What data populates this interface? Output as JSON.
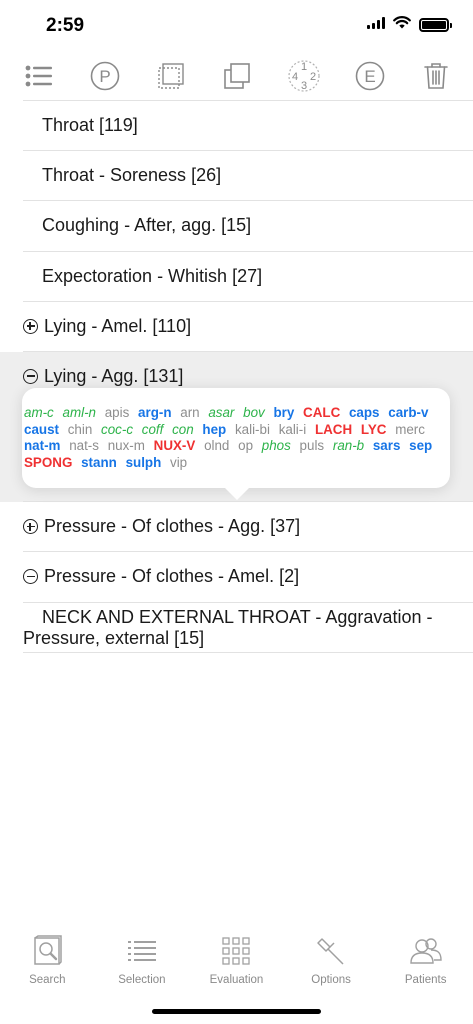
{
  "status": {
    "time": "2:59"
  },
  "toolbar": {
    "buttons": [
      {
        "icon": "list-icon"
      },
      {
        "icon": "p-circle-icon",
        "glyph": "P"
      },
      {
        "icon": "dotted-square-icon"
      },
      {
        "icon": "overlap-squares-icon"
      },
      {
        "icon": "grade-numbers-icon",
        "glyphs": [
          "1",
          "4",
          "2",
          "3"
        ]
      },
      {
        "icon": "e-circle-icon",
        "glyph": "E"
      },
      {
        "icon": "trash-icon"
      }
    ]
  },
  "rubrics": [
    {
      "label": "Throat [119]",
      "toggle": "none"
    },
    {
      "label": "Throat - Soreness [26]",
      "toggle": "none"
    },
    {
      "label": "Coughing - After, agg. [15]",
      "toggle": "none"
    },
    {
      "label": "Expectoration - Whitish [27]",
      "toggle": "none"
    },
    {
      "label": "Lying - Amel. [110]",
      "toggle": "plus"
    },
    {
      "label": "Lying - Agg. [131]",
      "toggle": "minus"
    },
    {
      "label": "Pressure - Of clothes - Agg. [37]",
      "toggle": "plus"
    },
    {
      "label": "Pressure - Of clothes - Amel. [2]",
      "toggle": "minus"
    },
    {
      "label_line1": "NECK AND EXTERNAL THROAT - Aggravation -",
      "label_line2": "Pressure, external [15]",
      "toggle": "none"
    }
  ],
  "popover": {
    "remedies": [
      {
        "name": "am-c",
        "grade": 2
      },
      {
        "name": "aml-n",
        "grade": 2
      },
      {
        "name": "apis",
        "grade": 1
      },
      {
        "name": "arg-n",
        "grade": 3
      },
      {
        "name": "arn",
        "grade": 1
      },
      {
        "name": "asar",
        "grade": 2
      },
      {
        "name": "bov",
        "grade": 2
      },
      {
        "name": "bry",
        "grade": 3
      },
      {
        "name": "CALC",
        "grade": 4
      },
      {
        "name": "caps",
        "grade": 3
      },
      {
        "name": "carb-v",
        "grade": 3
      },
      {
        "name": "caust",
        "grade": 3
      },
      {
        "name": "chin",
        "grade": 1
      },
      {
        "name": "coc-c",
        "grade": 2
      },
      {
        "name": "coff",
        "grade": 2
      },
      {
        "name": "con",
        "grade": 2
      },
      {
        "name": "hep",
        "grade": 3
      },
      {
        "name": "kali-bi",
        "grade": 1
      },
      {
        "name": "kali-i",
        "grade": 1
      },
      {
        "name": "LACH",
        "grade": 4
      },
      {
        "name": "LYC",
        "grade": 4
      },
      {
        "name": "merc",
        "grade": 1
      },
      {
        "name": "nat-m",
        "grade": 3
      },
      {
        "name": "nat-s",
        "grade": 1
      },
      {
        "name": "nux-m",
        "grade": 1
      },
      {
        "name": "NUX-V",
        "grade": 4
      },
      {
        "name": "olnd",
        "grade": 1
      },
      {
        "name": "op",
        "grade": 1
      },
      {
        "name": "phos",
        "grade": 2
      },
      {
        "name": "puls",
        "grade": 1
      },
      {
        "name": "ran-b",
        "grade": 2
      },
      {
        "name": "sars",
        "grade": 3
      },
      {
        "name": "sep",
        "grade": 3
      },
      {
        "name": "SPONG",
        "grade": 4
      },
      {
        "name": "stann",
        "grade": 3
      },
      {
        "name": "sulph",
        "grade": 3
      },
      {
        "name": "vip",
        "grade": 1
      }
    ],
    "colors": {
      "grade1": "#8e8e8e",
      "grade2": "#2db34a",
      "grade3": "#1775e6",
      "grade4": "#ef3132"
    }
  },
  "tabbar": {
    "tabs": [
      {
        "label": "Search",
        "icon": "search-book-icon",
        "active": true
      },
      {
        "label": "Selection",
        "icon": "selection-list-icon",
        "active": false
      },
      {
        "label": "Evaluation",
        "icon": "grid-icon",
        "active": false
      },
      {
        "label": "Options",
        "icon": "hammer-icon",
        "active": false
      },
      {
        "label": "Patients",
        "icon": "people-icon",
        "active": false
      }
    ]
  }
}
